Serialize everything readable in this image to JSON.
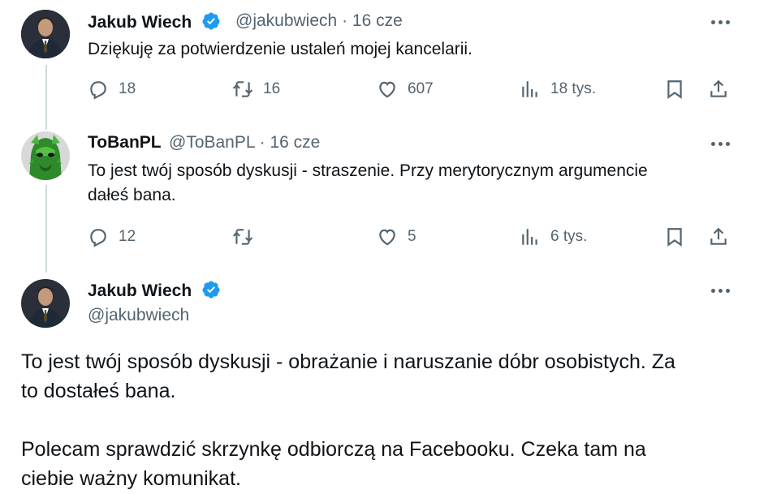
{
  "tweets": [
    {
      "name": "Jakub Wiech",
      "handle": "@jakubwiech",
      "date": "· 16 cze",
      "text": "Dziękuję za potwierdzenie ustaleń mojej kancelarii.",
      "replies": "18",
      "retweets": "16",
      "likes": "607",
      "views": "18 tys."
    },
    {
      "name": "ToBanPL",
      "handle": "@ToBanPL",
      "date": "· 16 cze",
      "text_line1": "To jest twój sposób dyskusji - straszenie. Przy merytorycznym argumencie",
      "text_line2": "dałeś bana.",
      "replies": "12",
      "retweets": "",
      "likes": "5",
      "views": "6 tys."
    }
  ],
  "main_tweet": {
    "name": "Jakub Wiech",
    "handle": "@jakubwiech",
    "para1_line1": "To jest twój sposób dyskusji - obrażanie i naruszanie dóbr osobistych. Za",
    "para1_line2": "to dostałeś bana.",
    "para2_line1": "Polecam sprawdzić skrzynkę odbiorczą na Facebooku. Czeka tam na",
    "para2_line2": "ciebie ważny komunikat."
  },
  "colors": {
    "verified": "#1d9bf0",
    "secondary_text": "#536471",
    "thread_line": "#cfd9de"
  }
}
